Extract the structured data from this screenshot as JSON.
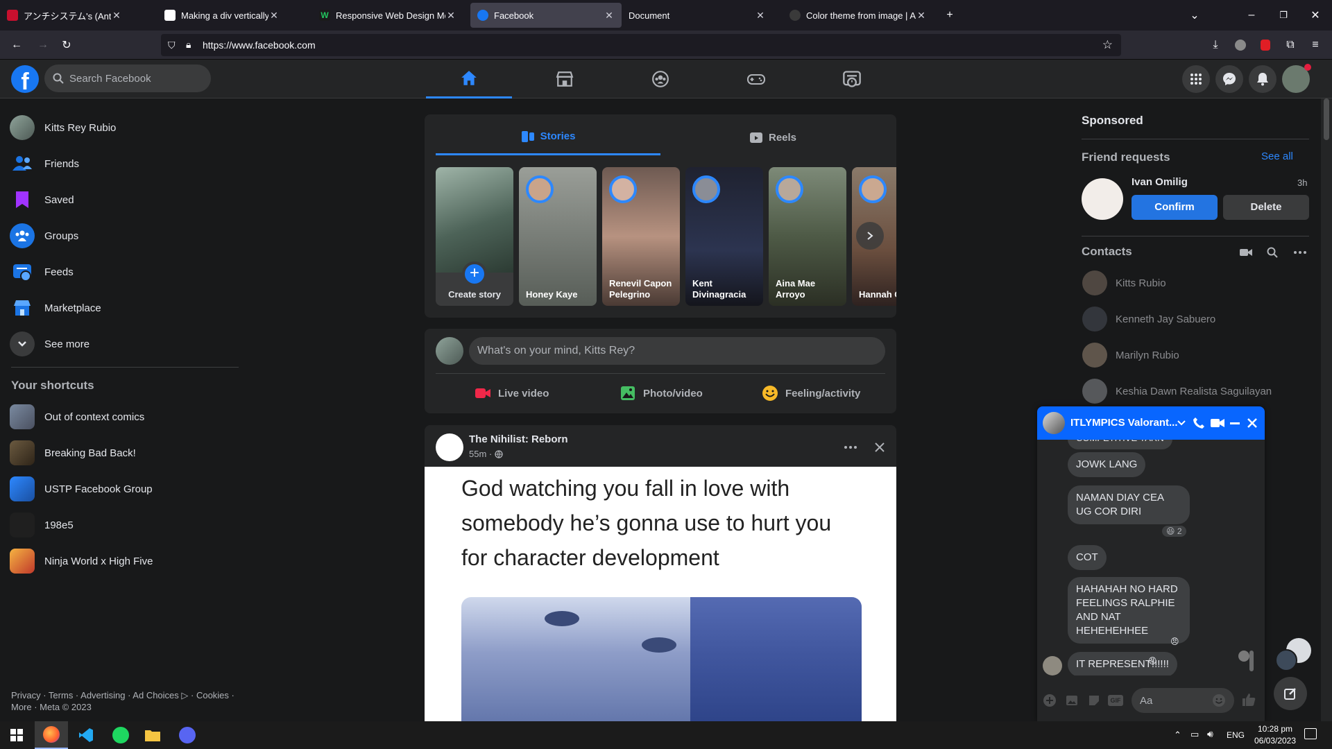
{
  "browser": {
    "tabs": [
      {
        "title": "アンチシステム's (AntiSystem",
        "active": false
      },
      {
        "title": "Making a div vertically scrollabl",
        "active": false
      },
      {
        "title": "Responsive Web Design Media",
        "active": false
      },
      {
        "title": "Facebook",
        "active": true
      },
      {
        "title": "Document",
        "active": false
      },
      {
        "title": "Color theme from image | Adol",
        "active": false
      }
    ],
    "url": "https://www.facebook.com"
  },
  "header": {
    "logo": "f",
    "search_placeholder": "Search Facebook",
    "nav_icons": [
      "home-icon",
      "marketplace-icon",
      "groups-icon",
      "gaming-icon",
      "feeds-icon"
    ]
  },
  "sidebar": {
    "items": [
      {
        "label": "Kitts Rey Rubio",
        "icon": "profile-avatar"
      },
      {
        "label": "Friends",
        "icon": "friends-icon"
      },
      {
        "label": "Saved",
        "icon": "saved-icon"
      },
      {
        "label": "Groups",
        "icon": "groups-icon"
      },
      {
        "label": "Feeds",
        "icon": "feeds-icon"
      },
      {
        "label": "Marketplace",
        "icon": "marketplace-icon"
      },
      {
        "label": "See more",
        "icon": "chevron-down-icon"
      }
    ],
    "shortcuts_title": "Your shortcuts",
    "shortcuts": [
      {
        "label": "Out of context comics"
      },
      {
        "label": "Breaking Bad Back!"
      },
      {
        "label": "USTP Facebook Group"
      },
      {
        "label": "198e5"
      },
      {
        "label": "Ninja World x High Five"
      }
    ],
    "footer_line1": "Privacy · Terms · Advertising · Ad Choices ▷ · Cookies ·",
    "footer_line2": "More · Meta © 2023"
  },
  "stories": {
    "tabs": [
      {
        "label": "Stories"
      },
      {
        "label": "Reels"
      }
    ],
    "items": [
      {
        "name": "Create story"
      },
      {
        "name": "Honey Kaye"
      },
      {
        "name": "Renevil Capon Pelegrino"
      },
      {
        "name": "Kent Divinagracia"
      },
      {
        "name": "Aina Mae Arroyo"
      },
      {
        "name": "Hannah Gaguan"
      }
    ]
  },
  "composer": {
    "placeholder": "What's on your mind, Kitts Rey?",
    "actions": [
      {
        "label": "Live video",
        "color": "#f02849"
      },
      {
        "label": "Photo/video",
        "color": "#45bd62"
      },
      {
        "label": "Feeling/activity",
        "color": "#f7b928"
      }
    ]
  },
  "post": {
    "author": "The Nihilist: Reborn",
    "time": "55m ·",
    "text": "God watching you fall in love with somebody he’s gonna use to hurt you for character development"
  },
  "right": {
    "sponsored": "Sponsored",
    "friend_requests_title": "Friend requests",
    "see_all": "See all",
    "request": {
      "name": "Ivan Omilig",
      "time": "3h",
      "confirm": "Confirm",
      "delete": "Delete"
    },
    "contacts_title": "Contacts",
    "contacts": [
      {
        "name": "Kitts Rubio"
      },
      {
        "name": "Kenneth Jay Sabuero"
      },
      {
        "name": "Marilyn Rubio"
      },
      {
        "name": "Keshia Dawn Realista Saguilayan"
      }
    ]
  },
  "chat": {
    "title": "ITLYMPICS Valorant...",
    "partial_top": "COMPETITIVE YARN",
    "messages": [
      {
        "text": "JOWK LANG"
      },
      {
        "text": "NAMAN DIAY CEA UG COR DIRI",
        "reaction": "😆 2"
      },
      {
        "text": "COT"
      },
      {
        "text": "HAHAHAH NO HARD FEELINGS RALPHIE AND NAT HEHEHEHHEE",
        "reaction": "😠"
      },
      {
        "text": "IT REPRESENT!!!!!!",
        "reaction": "😠"
      }
    ],
    "input_placeholder": "Aa",
    "header_color": "#0866ff"
  },
  "taskbar": {
    "lang": "ENG",
    "time": "10:28 pm",
    "date": "06/03/2023"
  },
  "colors": {
    "fb_blue": "#1877f2",
    "accent_blue": "#2d88ff",
    "bg": "#18191a",
    "card": "#242526"
  }
}
